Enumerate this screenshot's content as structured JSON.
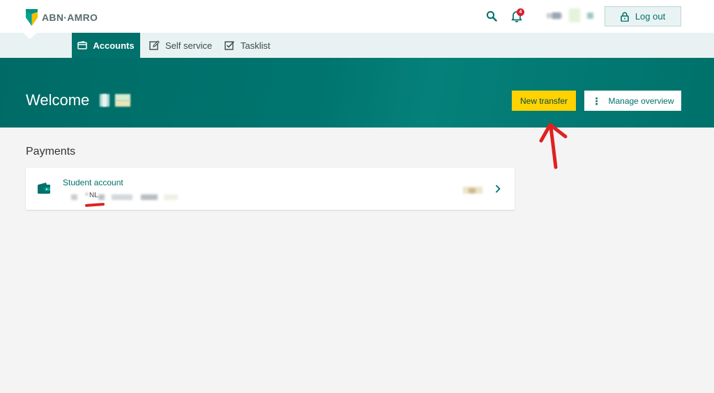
{
  "brand": {
    "name": "ABN·AMRO",
    "shield_colors": [
      "#009286",
      "#f3c000"
    ]
  },
  "header": {
    "notifications_count": "4",
    "logout_label": "Log out",
    "icons": [
      "search-icon",
      "bell-icon",
      "lock-icon"
    ]
  },
  "nav": {
    "tabs": [
      {
        "label": "Accounts",
        "icon": "wallet-icon",
        "active": true
      },
      {
        "label": "Self service",
        "icon": "edit-icon",
        "active": false
      },
      {
        "label": "Tasklist",
        "icon": "checkbox-icon",
        "active": false
      }
    ]
  },
  "hero": {
    "welcome": "Welcome",
    "new_transfer_label": "New transfer",
    "manage_overview_label": "Manage overview"
  },
  "payments": {
    "title": "Payments",
    "accounts": [
      {
        "name": "Student account",
        "iban_prefix": "NL"
      }
    ]
  },
  "colors": {
    "primary": "#00716b",
    "accent_yellow": "#ffd200",
    "nav_bg": "#e9f2f2",
    "page_bg": "#f4f4f4",
    "annotation": "#e02020"
  }
}
